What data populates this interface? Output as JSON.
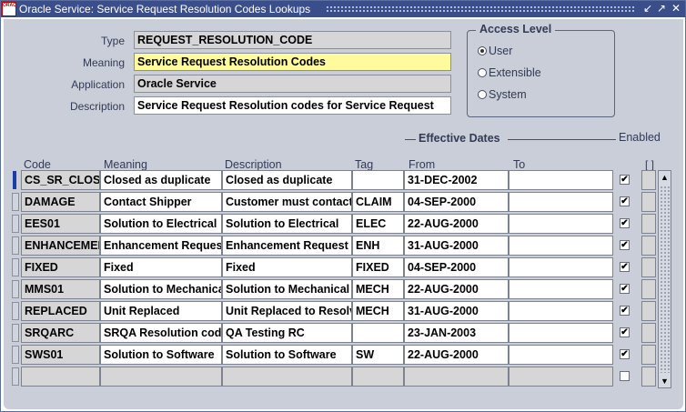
{
  "window": {
    "title": "Oracle Service: Service Request Resolution Codes Lookups",
    "logo_text": "ORACLE",
    "minimize_icon": "minimize-icon",
    "maximize_icon": "maximize-icon",
    "close_icon": "close-icon"
  },
  "header": {
    "type_label": "Type",
    "type_value": "REQUEST_RESOLUTION_CODE",
    "meaning_label": "Meaning",
    "meaning_value": "Service Request Resolution Codes",
    "application_label": "Application",
    "application_value": "Oracle Service",
    "description_label": "Description",
    "description_value": "Service Request Resolution codes for Service Request"
  },
  "access_level": {
    "title": "Access Level",
    "options": [
      {
        "label": "User",
        "selected": true
      },
      {
        "label": "Extensible",
        "selected": false
      },
      {
        "label": "System",
        "selected": false
      }
    ]
  },
  "table": {
    "effective_dates_label": "Effective Dates",
    "enabled_label": "Enabled",
    "flex_label": "[ ]",
    "columns": {
      "code": "Code",
      "meaning": "Meaning",
      "description": "Description",
      "tag": "Tag",
      "from": "From",
      "to": "To"
    },
    "rows": [
      {
        "code": "CS_SR_CLOSED",
        "meaning": "Closed as duplicate",
        "description": "Closed as duplicate",
        "tag": "",
        "from": "31-DEC-2002",
        "to": "",
        "enabled": true
      },
      {
        "code": "DAMAGE",
        "meaning": "Contact Shipper",
        "description": "Customer must contact shipper",
        "tag": "CLAIM",
        "from": "04-SEP-2000",
        "to": "",
        "enabled": true
      },
      {
        "code": "EES01",
        "meaning": "Solution to Electrical",
        "description": "Solution to Electrical",
        "tag": "ELEC",
        "from": "22-AUG-2000",
        "to": "",
        "enabled": true
      },
      {
        "code": "ENHANCEMENT",
        "meaning": "Enhancement Request",
        "description": "Enhancement Request",
        "tag": "ENH",
        "from": "31-AUG-2000",
        "to": "",
        "enabled": true
      },
      {
        "code": "FIXED",
        "meaning": "Fixed",
        "description": "Fixed",
        "tag": "FIXED",
        "from": "04-SEP-2000",
        "to": "",
        "enabled": true
      },
      {
        "code": "MMS01",
        "meaning": "Solution to Mechanical",
        "description": "Solution to Mechanical",
        "tag": "MECH",
        "from": "22-AUG-2000",
        "to": "",
        "enabled": true
      },
      {
        "code": "REPLACED",
        "meaning": "Unit Replaced",
        "description": "Unit Replaced to Resolve",
        "tag": "MECH",
        "from": "31-AUG-2000",
        "to": "",
        "enabled": true
      },
      {
        "code": "SRQARC",
        "meaning": "SRQA Resolution code",
        "description": "QA Testing RC",
        "tag": "",
        "from": "23-JAN-2003",
        "to": "",
        "enabled": true
      },
      {
        "code": "SWS01",
        "meaning": "Solution to Software",
        "description": "Solution to Software",
        "tag": "SW",
        "from": "22-AUG-2000",
        "to": "",
        "enabled": true
      },
      {
        "code": "",
        "meaning": "",
        "description": "",
        "tag": "",
        "from": "",
        "to": "",
        "enabled": false
      }
    ]
  }
}
